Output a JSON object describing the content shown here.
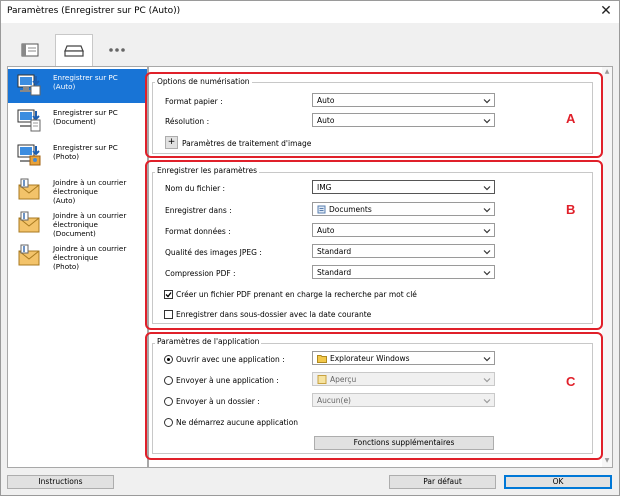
{
  "window": {
    "title": "Paramètres (Enregistrer sur PC (Auto))",
    "close_glyph": "✕"
  },
  "tabs": [
    {
      "name": "scan-settings-tab",
      "icon": "window-icon"
    },
    {
      "name": "save-settings-tab",
      "icon": "scanner-icon"
    },
    {
      "name": "more-tab",
      "icon": "ellipsis-icon"
    }
  ],
  "sidebar": {
    "items": [
      {
        "label": "Enregistrer sur PC\n(Auto)",
        "icon": "pc-save-auto-icon",
        "selected": true
      },
      {
        "label": "Enregistrer sur PC\n(Document)",
        "icon": "pc-save-document-icon"
      },
      {
        "label": "Enregistrer sur PC\n(Photo)",
        "icon": "pc-save-photo-icon"
      },
      {
        "label": "Joindre à un courrier\nélectronique\n(Auto)",
        "icon": "email-attach-auto-icon"
      },
      {
        "label": "Joindre à un courrier\nélectronique\n(Document)",
        "icon": "email-attach-document-icon"
      },
      {
        "label": "Joindre à un courrier\nélectronique\n(Photo)",
        "icon": "email-attach-photo-icon"
      }
    ]
  },
  "section_a": {
    "letter": "A",
    "title": "Options de numérisation",
    "paper_size": {
      "label": "Format papier :",
      "value": "Auto"
    },
    "resolution": {
      "label": "Résolution :",
      "value": "Auto"
    },
    "image_processing": {
      "expand_glyph": "+",
      "label": "Paramètres de traitement d'image"
    }
  },
  "section_b": {
    "letter": "B",
    "title": "Enregistrer les paramètres",
    "file_name": {
      "label": "Nom du fichier :",
      "value": "IMG"
    },
    "save_in": {
      "label": "Enregistrer dans :",
      "value": "Documents"
    },
    "data_format": {
      "label": "Format données :",
      "value": "Auto"
    },
    "jpeg_quality": {
      "label": "Qualité des images JPEG :",
      "value": "Standard"
    },
    "pdf_compression": {
      "label": "Compression PDF :",
      "value": "Standard"
    },
    "searchable_pdf": {
      "label": "Créer un fichier PDF prenant en charge la recherche par mot clé",
      "checked": true
    },
    "date_subfolder": {
      "label": "Enregistrer dans sous-dossier avec la date courante",
      "checked": false
    }
  },
  "section_c": {
    "letter": "C",
    "title": "Paramètres de l'application",
    "open_with": {
      "label": "Ouvrir avec une application :",
      "value": "Explorateur Windows",
      "selected": true
    },
    "send_to_app": {
      "label": "Envoyer à une application :",
      "value": "Aperçu"
    },
    "send_to_folder": {
      "label": "Envoyer à un dossier :",
      "value": "Aucun(e)"
    },
    "no_app": {
      "label": "Ne démarrez aucune application"
    },
    "more_functions": "Fonctions supplémentaires"
  },
  "footer": {
    "instructions": "Instructions",
    "defaults": "Par défaut",
    "ok": "OK"
  },
  "colors": {
    "accent": "#1874d6",
    "annotation": "#e0202a"
  }
}
